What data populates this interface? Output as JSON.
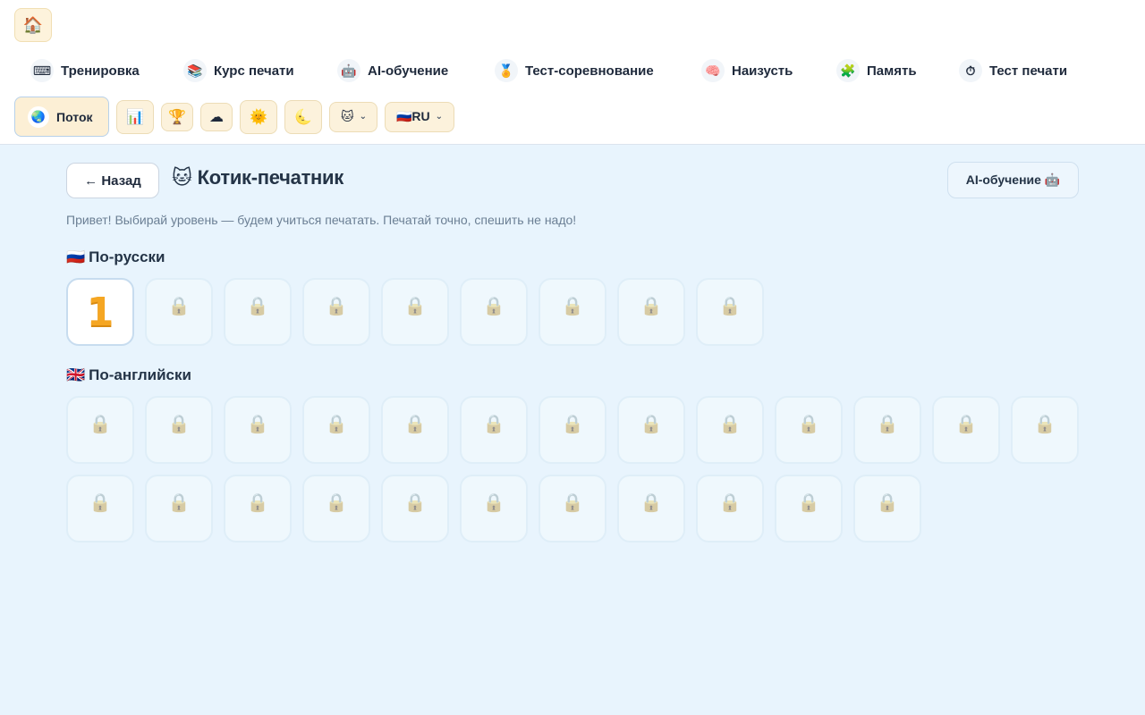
{
  "header": {
    "home_icon": "house-icon",
    "nav": [
      {
        "label": "Тренировка",
        "icon": "keyboard-icon",
        "glyph": "⌨"
      },
      {
        "label": "Курс печати",
        "icon": "books-icon",
        "glyph": "📚"
      },
      {
        "label": "AI-обучение",
        "icon": "robot-icon",
        "glyph": "🤖"
      },
      {
        "label": "Тест-соревнование",
        "icon": "trophy-character-icon",
        "glyph": "🏅"
      },
      {
        "label": "Наизусть",
        "icon": "brain-icon",
        "glyph": "🧠"
      },
      {
        "label": "Память",
        "icon": "puzzle-icon",
        "glyph": "🧩"
      },
      {
        "label": "Тест печати",
        "icon": "stopwatch-icon",
        "glyph": "⏱"
      }
    ],
    "flow_label": "Поток",
    "flow_icon": "globe-icon",
    "cat_select_value": "🐱",
    "lang_select_value": "🇷🇺RU"
  },
  "page": {
    "back_label": "← Назад",
    "title_emoji": "🐱",
    "title": "Котик-печатник",
    "ai_button_label": "AI-обучение 🤖",
    "subtitle": "Привет! Выбирай уровень — будем учиться печатать. Печатай точно, спешить не надо!",
    "sections": [
      {
        "flag": "🇷🇺",
        "title": "По-русски",
        "active_level": "1",
        "locked_count": 8
      },
      {
        "flag": "🇬🇧",
        "title": "По-английски",
        "active_level": null,
        "locked_count": 24
      }
    ]
  }
}
